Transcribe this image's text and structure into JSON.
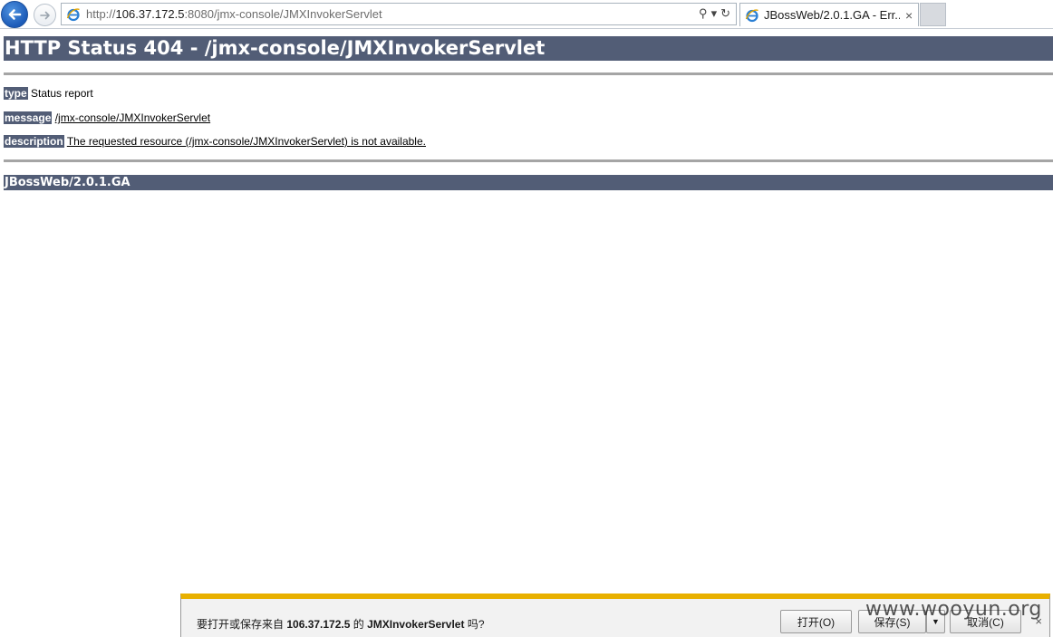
{
  "browser": {
    "url_prefix": "http://",
    "url_host": "106.37.172.5",
    "url_rest": ":8080/jmx-console/JMXInvokerServlet",
    "search_icon": "⚲",
    "dropdown_icon": "▾",
    "refresh_icon": "↻",
    "tab_title": "JBossWeb/2.0.1.GA - Err...",
    "tab_close": "×"
  },
  "page": {
    "heading": "HTTP Status 404 - /jmx-console/JMXInvokerServlet",
    "type_label": "type",
    "type_value": "Status report",
    "message_label": "message",
    "message_value": "/jmx-console/JMXInvokerServlet",
    "description_label": "description",
    "description_value": "The requested resource (/jmx-console/JMXInvokerServlet) is not available.",
    "footer": "JBossWeb/2.0.1.GA"
  },
  "download_bar": {
    "text_before": "要打开或保存来自 ",
    "host": "106.37.172.5",
    "text_mid": " 的 ",
    "filename": "JMXInvokerServlet",
    "text_after": " 吗?",
    "open_label": "打开(O)",
    "save_label": "保存(S)",
    "save_dropdown": "▼",
    "cancel_label": "取消(C)",
    "close": "×"
  },
  "watermark": "www.wooyun.org",
  "colors": {
    "header_bg": "#525d76",
    "download_accent": "#e8b000"
  }
}
